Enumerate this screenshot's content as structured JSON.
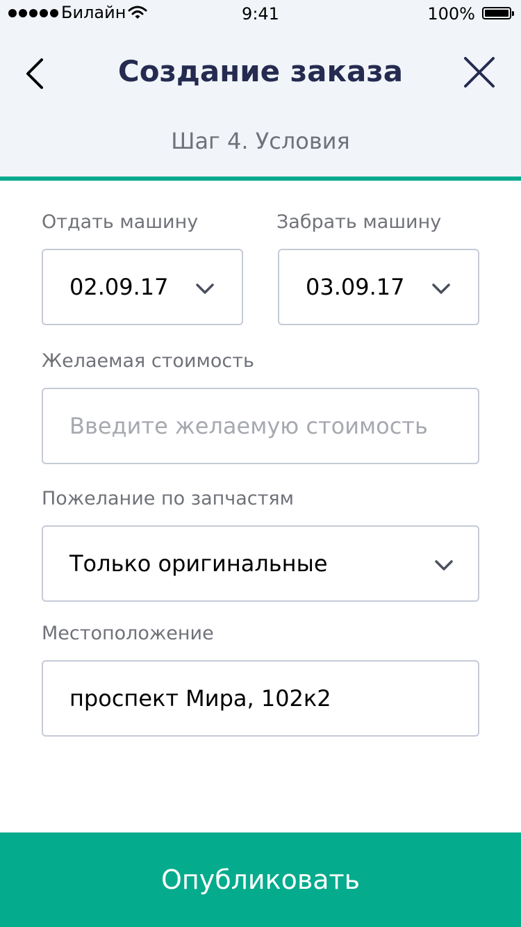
{
  "status_bar": {
    "carrier": "Билайн",
    "time": "9:41",
    "battery": "100%"
  },
  "header": {
    "title": "Создание заказа",
    "step": "Шаг 4. Условия"
  },
  "form": {
    "dropoff": {
      "label": "Отдать машину",
      "value": "02.09.17"
    },
    "pickup": {
      "label": "Забрать машину",
      "value": "03.09.17"
    },
    "price": {
      "label": "Желаемая стоимость",
      "placeholder": "Введите желаемую стоимость"
    },
    "parts": {
      "label": "Пожелание по запчастям",
      "value": "Только оригинальные"
    },
    "location": {
      "label": "Местоположение",
      "value": "проспект Мира, 102к2"
    }
  },
  "publish_label": "Опубликовать",
  "colors": {
    "accent": "#05ab8d",
    "title": "#252b50",
    "header_bg": "#f1f4f9"
  },
  "icons": {
    "back": "chevron-left-icon",
    "close": "close-icon",
    "dropdown": "chevron-down-icon",
    "wifi": "wifi-icon",
    "battery": "battery-icon"
  }
}
